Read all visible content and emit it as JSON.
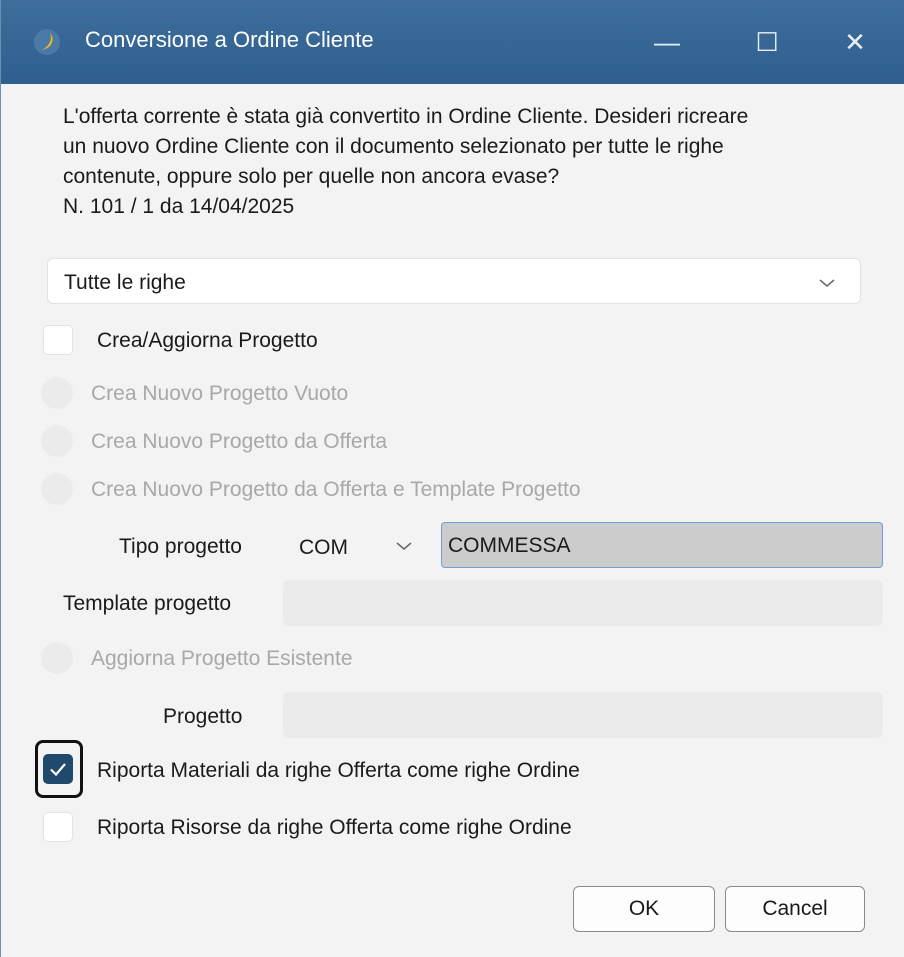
{
  "window": {
    "title": "Conversione a Ordine Cliente",
    "minimize": "—",
    "maximize": "☐",
    "close": "✕"
  },
  "message": {
    "lines": [
      "L'offerta corrente è stata già convertito in Ordine Cliente. Desideri ricreare",
      "un nuovo Ordine Cliente con il documento selezionato per tutte le righe",
      "contenute, oppure solo per quelle non ancora evase?",
      "N. 101 / 1 da 14/04/2025"
    ]
  },
  "rows_select": {
    "value": "Tutte le righe"
  },
  "project": {
    "create_update_label": "Crea/Aggiorna Progetto",
    "create_update_checked": false,
    "option_empty": "Crea Nuovo Progetto Vuoto",
    "option_from_offer": "Crea Nuovo Progetto da Offerta",
    "option_from_offer_template": "Crea Nuovo Progetto da Offerta e Template Progetto",
    "type_label": "Tipo progetto",
    "type_code": "COM",
    "type_description": "COMMESSA",
    "template_label": "Template progetto",
    "template_value": "",
    "option_update_existing": "Aggiorna Progetto Esistente",
    "project_label": "Progetto",
    "project_value": ""
  },
  "options": {
    "materials_label": "Riporta Materiali da righe Offerta come righe Ordine",
    "materials_checked": true,
    "resources_label": "Riporta Risorse da righe Offerta come righe Ordine",
    "resources_checked": false
  },
  "buttons": {
    "ok": "OK",
    "cancel": "Cancel"
  },
  "colors": {
    "titlebar": "#2e5f8e",
    "checked_accent": "#1f4a6e",
    "focus_border": "#6f9fd6",
    "disabled_text": "#a8a8a8"
  }
}
